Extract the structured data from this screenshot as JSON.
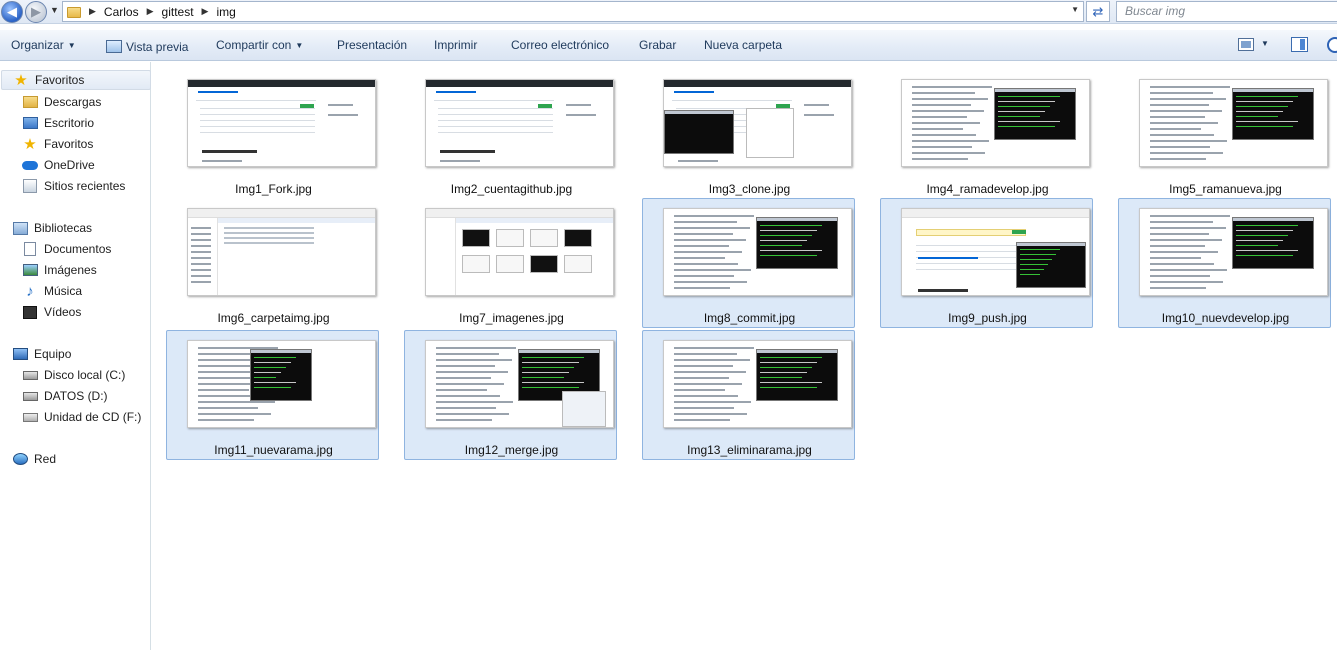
{
  "address_bar": {
    "breadcrumbs": [
      "Carlos",
      "gittest",
      "img"
    ],
    "search_placeholder": "Buscar img"
  },
  "toolbar": {
    "organize": "Organizar",
    "preview": "Vista previa",
    "share": "Compartir con",
    "slideshow": "Presentación",
    "print": "Imprimir",
    "email": "Correo electrónico",
    "burn": "Grabar",
    "new_folder": "Nueva carpeta"
  },
  "nav": {
    "favorites_header": "Favoritos",
    "favorites": [
      "Descargas",
      "Escritorio",
      "Favoritos",
      "OneDrive",
      "Sitios recientes"
    ],
    "libraries_header": "Bibliotecas",
    "libraries": [
      "Documentos",
      "Imágenes",
      "Música",
      "Vídeos"
    ],
    "computer_header": "Equipo",
    "drives": [
      "Disco local (C:)",
      "DATOS (D:)",
      "Unidad de CD (F:)"
    ],
    "network": "Red"
  },
  "files": [
    {
      "name": "Img1_Fork.jpg",
      "selected": false,
      "kind": "github-repo"
    },
    {
      "name": "Img2_cuentagithub.jpg",
      "selected": false,
      "kind": "github-repo"
    },
    {
      "name": "Img3_clone.jpg",
      "selected": false,
      "kind": "github-clone"
    },
    {
      "name": "Img4_ramadevelop.jpg",
      "selected": false,
      "kind": "doc-terminal"
    },
    {
      "name": "Img5_ramanueva.jpg",
      "selected": false,
      "kind": "doc-terminal"
    },
    {
      "name": "Img6_carpetaimg.jpg",
      "selected": false,
      "kind": "explorer-list"
    },
    {
      "name": "Img7_imagenes.jpg",
      "selected": false,
      "kind": "explorer-thumbs"
    },
    {
      "name": "Img8_commit.jpg",
      "selected": true,
      "kind": "doc-terminal"
    },
    {
      "name": "Img9_push.jpg",
      "selected": true,
      "kind": "github-push"
    },
    {
      "name": "Img10_nuevdevelop.jpg",
      "selected": true,
      "kind": "doc-terminal"
    },
    {
      "name": "Img11_nuevarama.jpg",
      "selected": true,
      "kind": "doc-terminal-left"
    },
    {
      "name": "Img12_merge.jpg",
      "selected": true,
      "kind": "doc-terminal-dialog"
    },
    {
      "name": "Img13_eliminarama.jpg",
      "selected": true,
      "kind": "doc-terminal"
    }
  ]
}
